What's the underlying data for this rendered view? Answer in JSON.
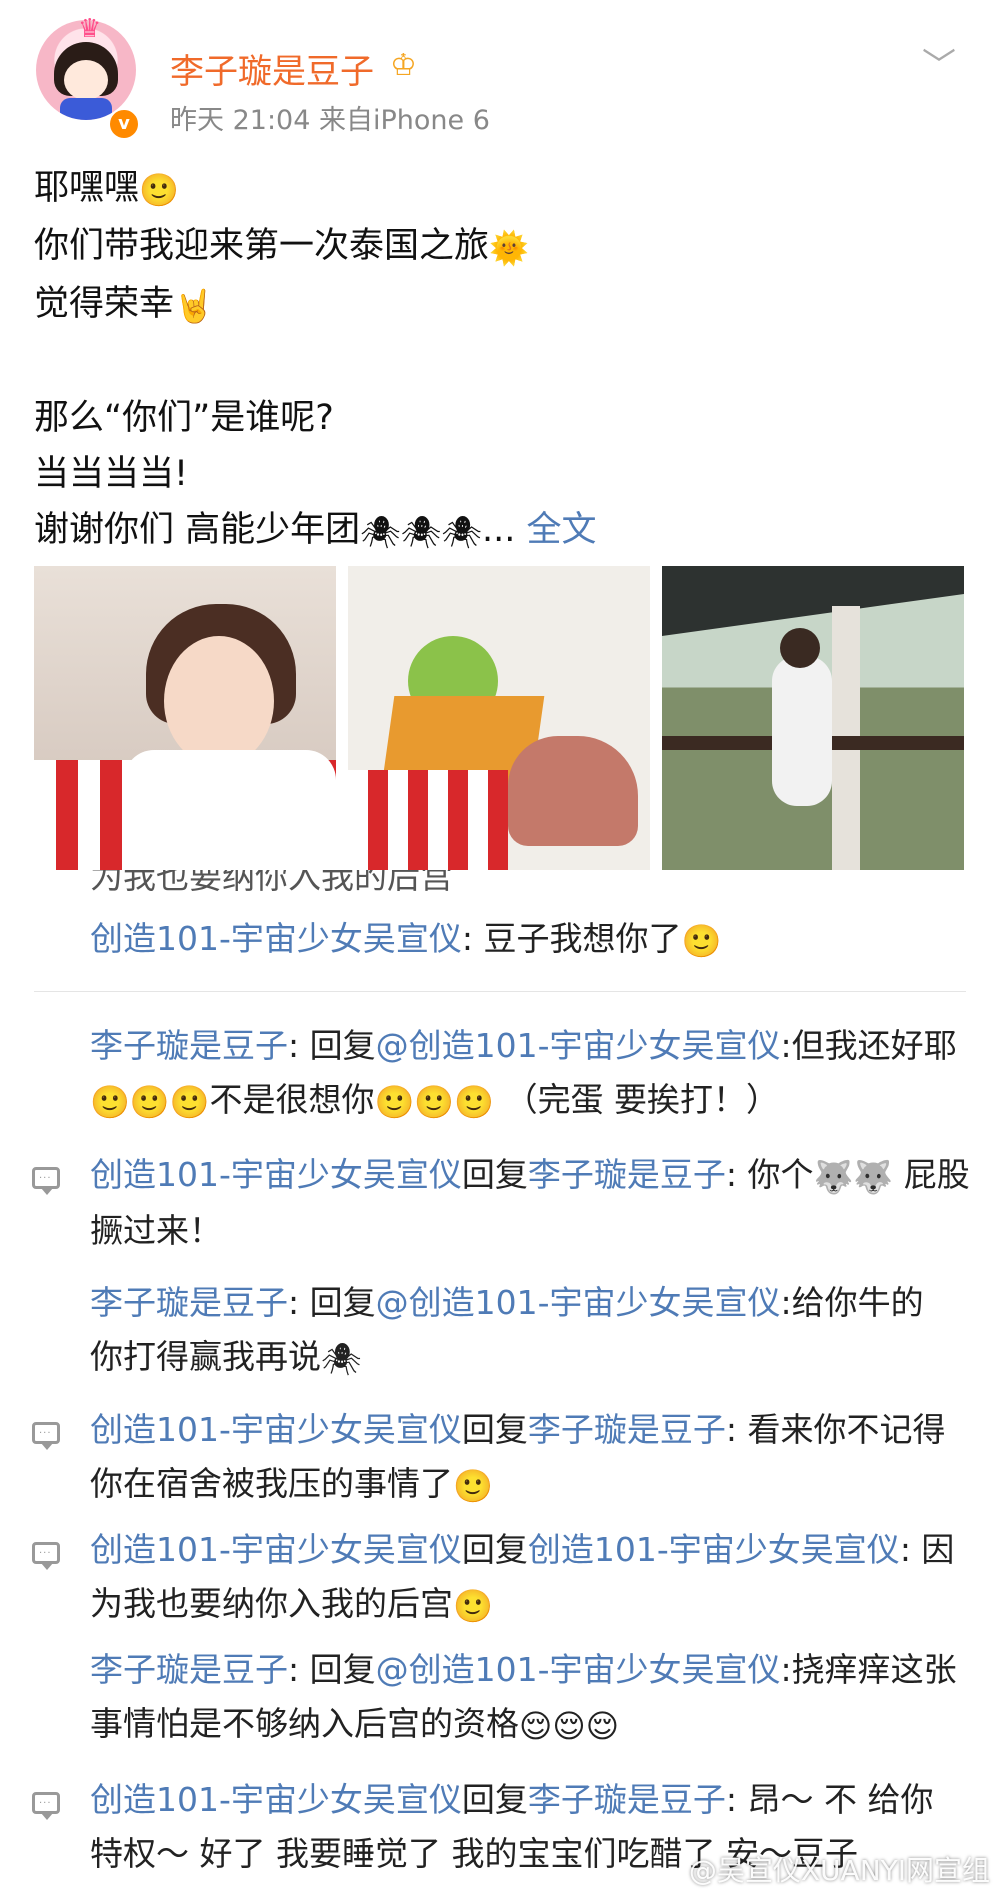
{
  "header": {
    "username": "李子璇是豆子",
    "time": "昨天 21:04",
    "source": "来自iPhone 6"
  },
  "post": {
    "line1": "耶嘿嘿",
    "line2": "你们带我迎来第一次泰国之旅",
    "line3": "觉得荣幸",
    "line4": "那么“你们”是谁呢?",
    "line5": "当当当当!",
    "line6": "谢谢你们 高能少年团",
    "ellipsis": "...",
    "full_text_link": "全文"
  },
  "comments": {
    "partial_top": "为我也要纳你入我的后宫",
    "c1_name": "创造101-宇宙少女吴宣仪",
    "c1_text": ": 豆子我想你了",
    "c2_name": "李子璇是豆子",
    "c2_reply": ": 回复",
    "c2_target": "@创造101-宇宙少女吴宣仪",
    "c2_text": ":但我还好耶",
    "c2_text2": "不是很想你",
    "c2_text3": "（完蛋 要挨打！）",
    "c3_name": "创造101-宇宙少女吴宣仪",
    "c3_reply": "回复",
    "c3_target": "李子璇是豆子",
    "c3_text": ": 你个",
    "c3_text2": "屁股撅过来！",
    "c4_name": "李子璇是豆子",
    "c4_reply": ": 回复",
    "c4_target": "@创造101-宇宙少女吴宣仪",
    "c4_text": ":给你牛的",
    "c4_text2": "你打得赢我再说",
    "c5_name": "创造101-宇宙少女吴宣仪",
    "c5_reply": "回复",
    "c5_target": "李子璇是豆子",
    "c5_text": ": 看来你不记得",
    "c5_text2": "你在宿舍被我压的事情了",
    "c6_name": "创造101-宇宙少女吴宣仪",
    "c6_reply": "回复",
    "c6_target": "创造101-宇宙少女吴宣仪",
    "c6_text": ": 因",
    "c6_text2": "为我也要纳你入我的后宫",
    "c7_name": "李子璇是豆子",
    "c7_reply": ": 回复",
    "c7_target": "@创造101-宇宙少女吴宣仪",
    "c7_text": ":挠痒痒这张",
    "c7_text2": "事情怕是不够纳入后宫的资格",
    "c8_name": "创造101-宇宙少女吴宣仪",
    "c8_reply": "回复",
    "c8_target": "李子璇是豆子",
    "c8_text": ": 昂～ 不 给你",
    "c8_text2": "特权～ 好了 我要睡觉了 我的宝宝们吃醋了 安～豆子"
  },
  "watermark": "@吴宣仪XUANYI网宣组",
  "icons": {
    "minion": "minion-emoji",
    "smile": "smile-emoji",
    "spiderman": "spiderman-emoji",
    "rock": "rock-hand-emoji",
    "husky": "husky-emoji",
    "shy": "shy-emoji"
  },
  "colors": {
    "name_orange": "#f06a2a",
    "link_blue": "#4f7bb6",
    "meta_gray": "#888888"
  }
}
